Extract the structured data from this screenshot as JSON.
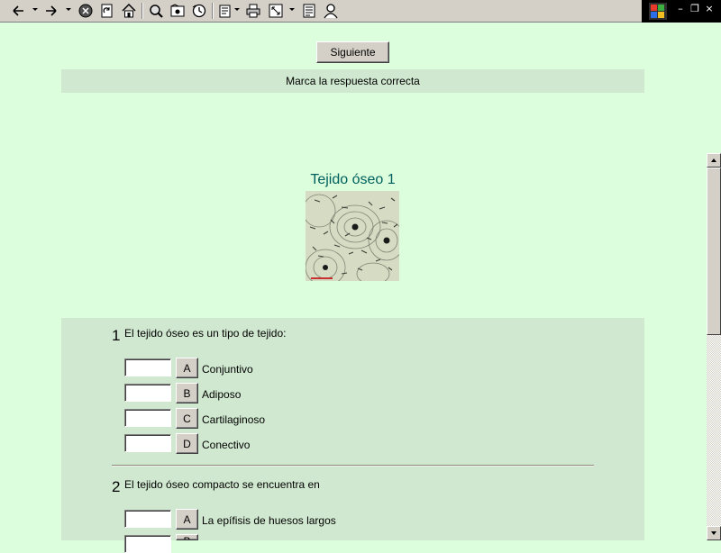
{
  "toolbar": {
    "icons": [
      "back-icon",
      "forward-icon",
      "stop-icon",
      "refresh-icon",
      "home-icon",
      "search-icon",
      "favorites-icon",
      "history-icon",
      "mail-icon",
      "print-icon",
      "fullscreen-icon",
      "edit-icon",
      "messenger-icon"
    ]
  },
  "window_controls": {
    "minimize": "–",
    "restore": "❐",
    "close": "×"
  },
  "navigation": {
    "next_label": "Siguiente"
  },
  "instruction": "Marca la respuesta correcta",
  "title": "Tejido óseo 1",
  "questions": [
    {
      "number": "1",
      "text": "El tejido óseo es un tipo de tejido:",
      "options": [
        {
          "letter": "A",
          "text": "Conjuntivo"
        },
        {
          "letter": "B",
          "text": "Adiposo"
        },
        {
          "letter": "C",
          "text": "Cartilaginoso"
        },
        {
          "letter": "D",
          "text": "Conectivo"
        }
      ]
    },
    {
      "number": "2",
      "text": "El tejido óseo compacto se encuentra en",
      "options": [
        {
          "letter": "A",
          "text": "La epífisis de huesos largos"
        },
        {
          "letter": "B",
          "text": ""
        }
      ]
    }
  ],
  "colors": {
    "page_background": "#dcfedc",
    "panel_background": "#d0e8d0",
    "title_color": "#006060"
  }
}
